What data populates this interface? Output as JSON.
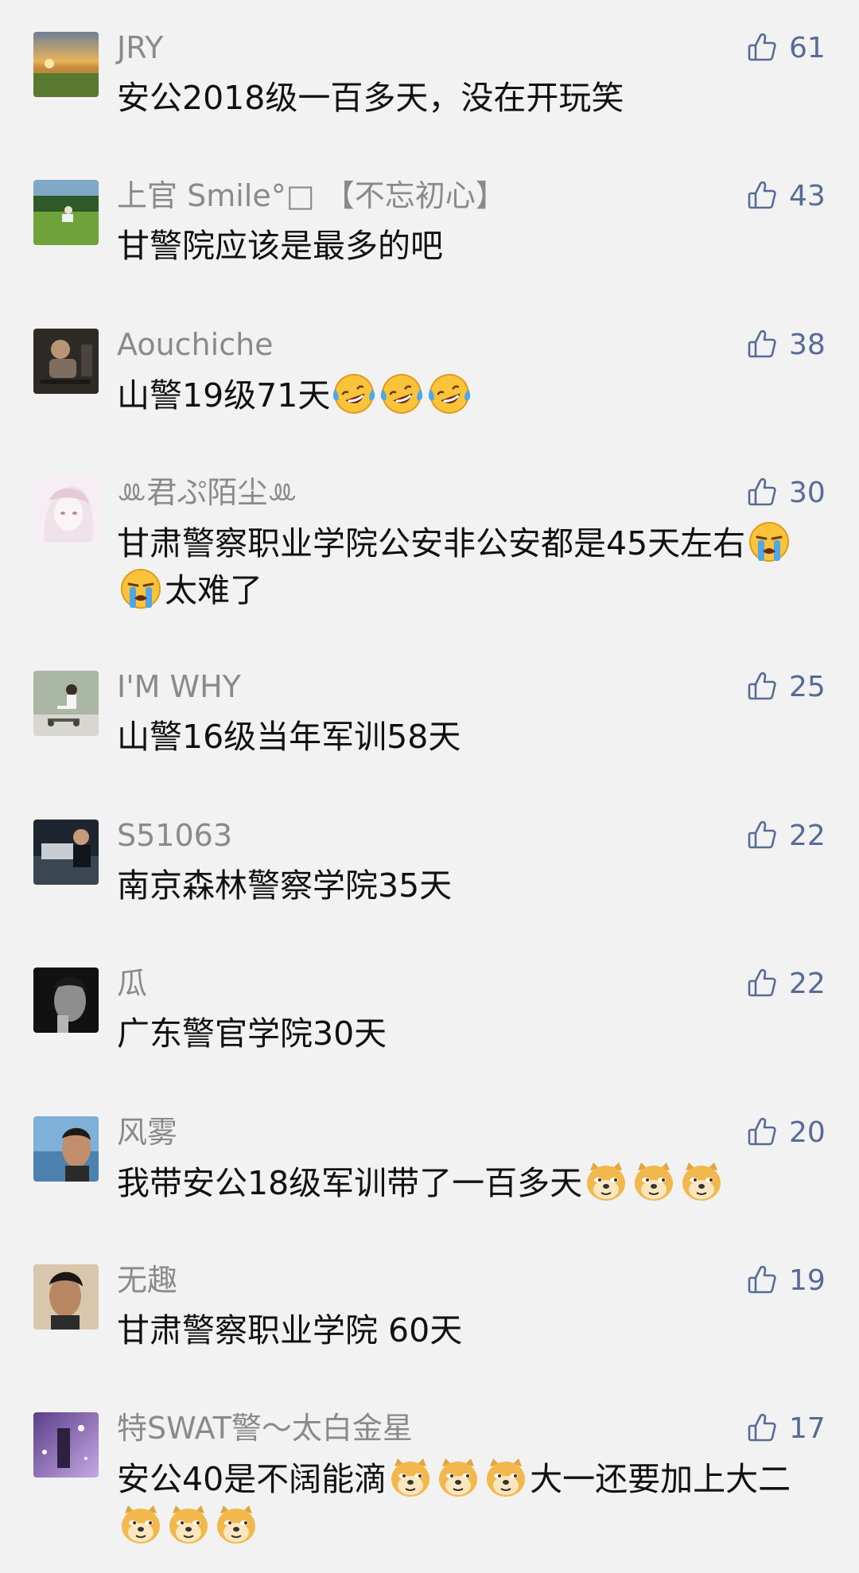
{
  "colors": {
    "background": "#f2f2f2",
    "nickname": "#8a8a8a",
    "content": "#111111",
    "like_accent": "#576b95"
  },
  "comments": [
    {
      "nickname": "JRY",
      "text": "安公2018级一百多天，没在开玩笑",
      "text_after_emoji": "",
      "emojis": [],
      "emojis_trailing": [],
      "likes": "61",
      "avatar_icon": "sunset-field-photo"
    },
    {
      "nickname": "上官 Smile°□ 【不忘初心】",
      "text": "甘警院应该是最多的吧",
      "text_after_emoji": "",
      "emojis": [],
      "emojis_trailing": [],
      "likes": "43",
      "avatar_icon": "grass-park-photo"
    },
    {
      "nickname": "Aouchiche",
      "text": "山警19级71天",
      "text_after_emoji": "",
      "emojis": [
        "laughing-crying-emoji",
        "laughing-crying-emoji",
        "laughing-crying-emoji"
      ],
      "emojis_trailing": [],
      "likes": "38",
      "avatar_icon": "skateboarder-photo"
    },
    {
      "nickname": "ꔛ君ぷ陌尘ꔛ",
      "text": "甘肃警察职业学院公安非公安都是45天左右",
      "text_after_emoji": "太难了",
      "emojis": [
        "loudly-crying-emoji",
        "loudly-crying-emoji"
      ],
      "emojis_trailing": [],
      "likes": "30",
      "avatar_icon": "anime-girl-illustration"
    },
    {
      "nickname": "I'M WHY",
      "text": "山警16级当年军训58天",
      "text_after_emoji": "",
      "emojis": [],
      "emojis_trailing": [],
      "likes": "25",
      "avatar_icon": "child-scooter-photo"
    },
    {
      "nickname": "S51063",
      "text": "南京森林警察学院35天",
      "text_after_emoji": "",
      "emojis": [],
      "emojis_trailing": [],
      "likes": "22",
      "avatar_icon": "police-car-photo"
    },
    {
      "nickname": "瓜",
      "text": "广东警官学院30天",
      "text_after_emoji": "",
      "emojis": [],
      "emojis_trailing": [],
      "likes": "22",
      "avatar_icon": "bw-portrait-photo"
    },
    {
      "nickname": "风雾",
      "text": "我带安公18级军训带了一百多天",
      "text_after_emoji": "",
      "emojis": [
        "doge-emoji",
        "doge-emoji",
        "doge-emoji"
      ],
      "emojis_trailing": [],
      "likes": "20",
      "avatar_icon": "seaside-portrait-photo"
    },
    {
      "nickname": "无趣",
      "text": "甘肃警察职业学院  60天",
      "text_after_emoji": "",
      "emojis": [],
      "emojis_trailing": [],
      "likes": "19",
      "avatar_icon": "selfie-portrait-photo"
    },
    {
      "nickname": "特SWAT警～太白金星",
      "text": "安公40是不阔能滴",
      "text_after_emoji": "大一还要加上大二",
      "emojis": [
        "doge-emoji",
        "doge-emoji",
        "doge-emoji"
      ],
      "emojis_trailing": [
        "doge-emoji",
        "doge-emoji",
        "doge-emoji"
      ],
      "likes": "17",
      "avatar_icon": "purple-night-photo"
    }
  ]
}
